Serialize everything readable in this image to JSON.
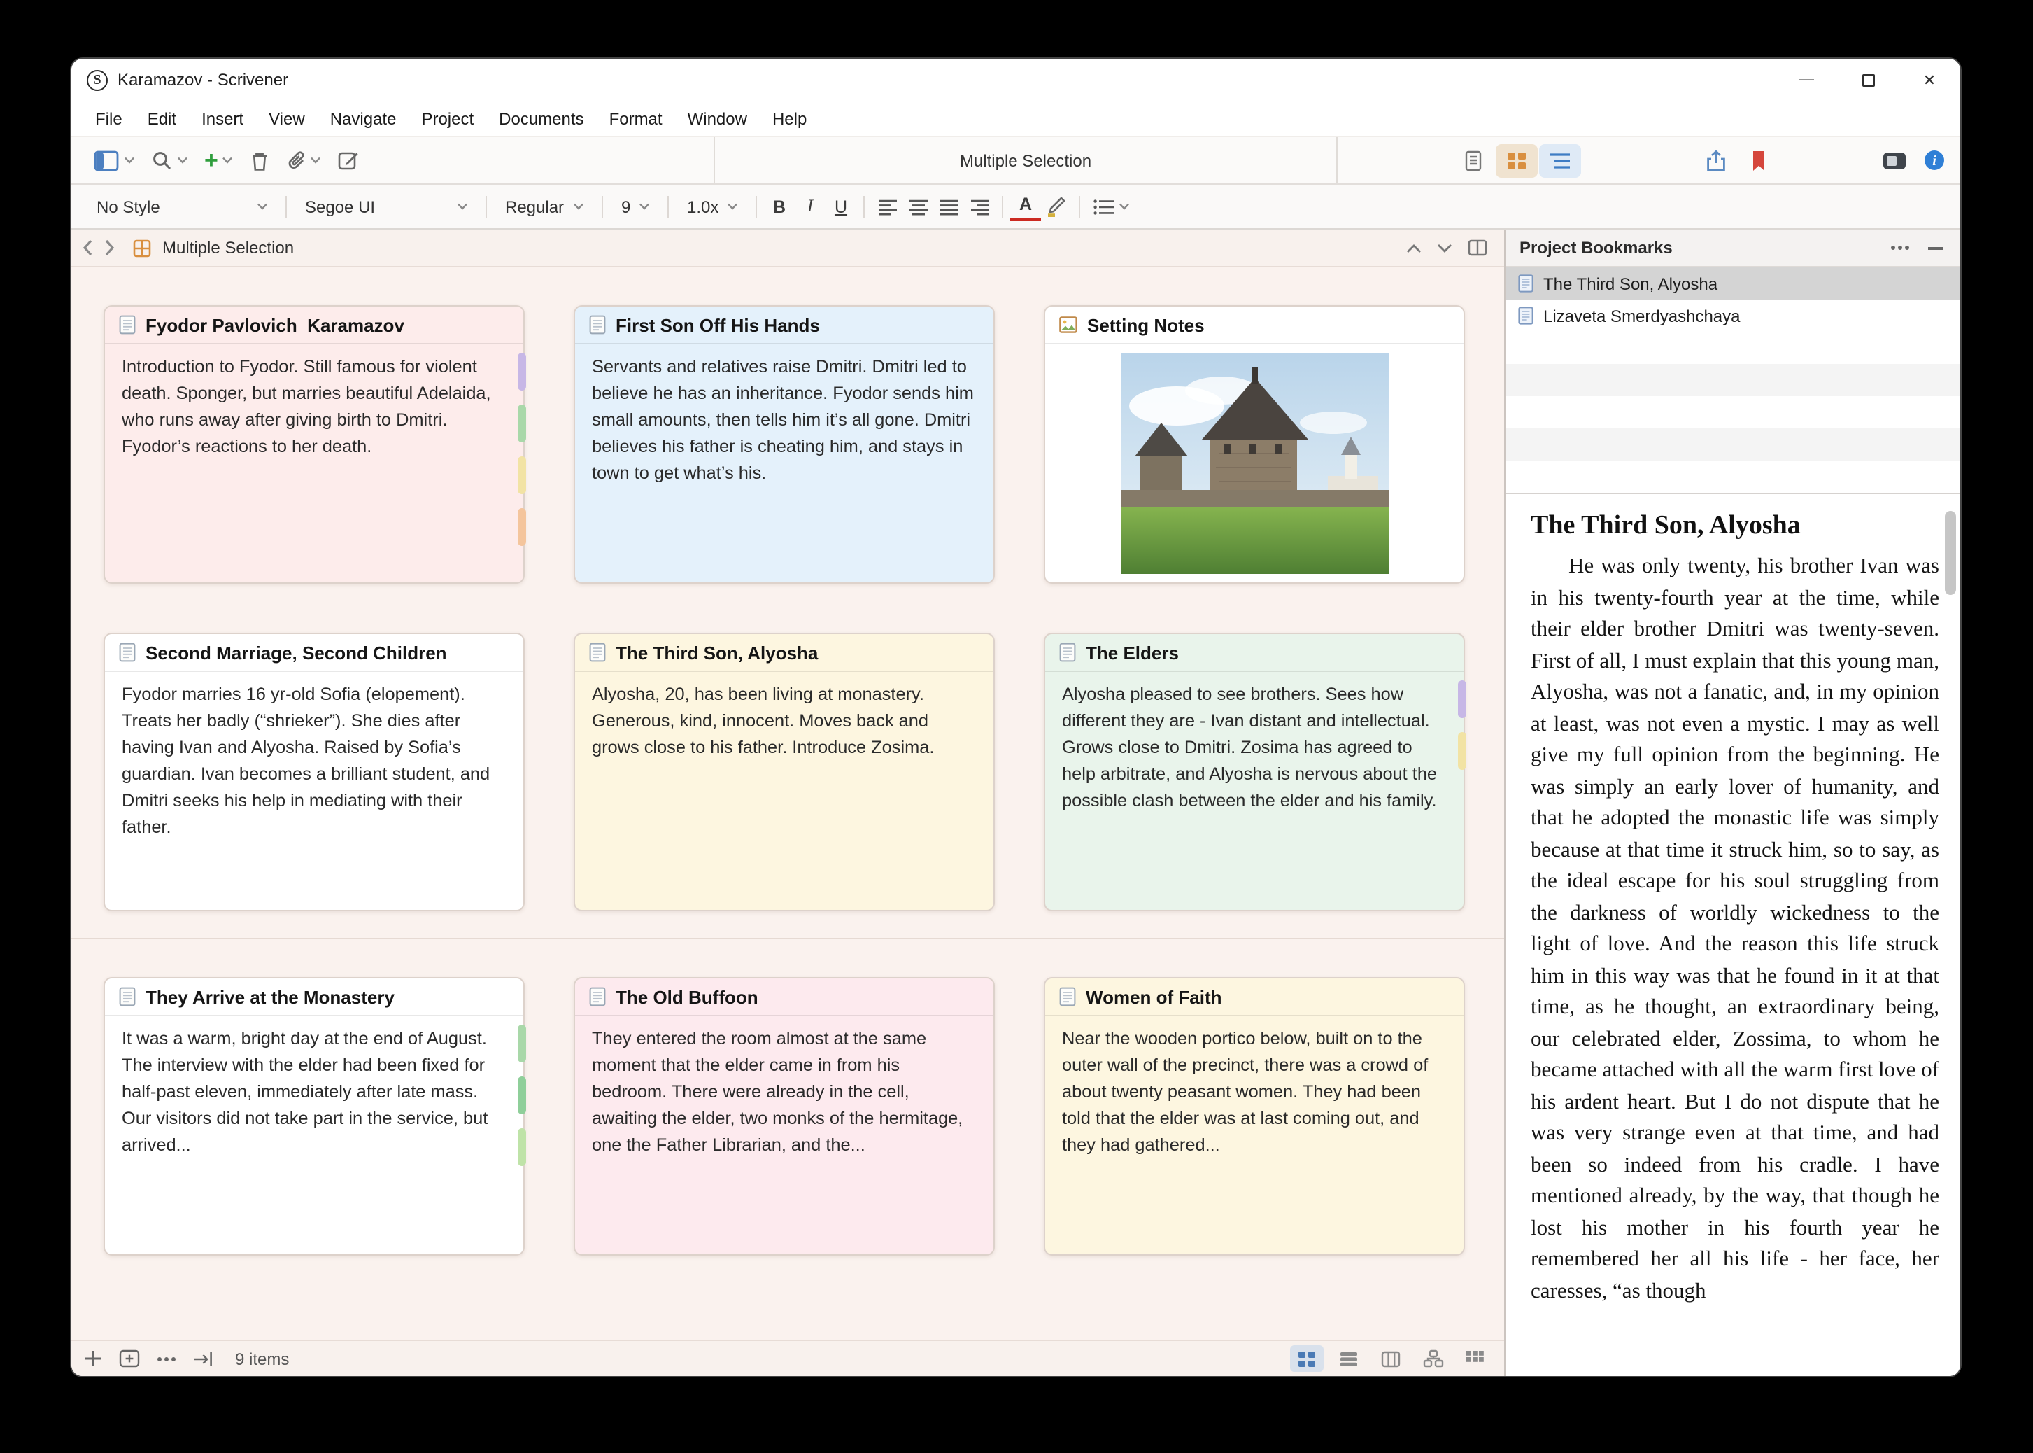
{
  "window": {
    "title": "Karamazov - Scrivener",
    "controls": {
      "minimize": "—",
      "maximize": "▢",
      "close": "✕"
    }
  },
  "menu": {
    "items": [
      "File",
      "Edit",
      "Insert",
      "View",
      "Navigate",
      "Project",
      "Documents",
      "Format",
      "Window",
      "Help"
    ]
  },
  "toolbar": {
    "document_title": "Multiple Selection"
  },
  "format_bar": {
    "style": "No Style",
    "font": "Segoe UI",
    "variant": "Regular",
    "size": "9",
    "line_spacing": "1.0x",
    "bold": "B",
    "italic": "I",
    "underline": "U",
    "color_letter": "A"
  },
  "editor_header": {
    "title": "Multiple Selection"
  },
  "icons": {
    "app-logo": "S-circle",
    "layout": "split-rectangle",
    "search": "magnifier",
    "add": "+",
    "trash": "trash-can",
    "attach": "paperclip",
    "compose": "square-pencil",
    "view-document": "page",
    "view-corkboard": "amber-grid",
    "view-outline": "blue-lines",
    "share": "arrow-up-box",
    "bookmark": "red-flag",
    "quick-reference": "dark-panel",
    "info": "blue-i",
    "back": "chevron-left",
    "forward": "chevron-right",
    "up": "chevron-up",
    "down": "chevron-down",
    "more": "three-dots",
    "collapse": "minus"
  },
  "corkboard": {
    "cards": [
      {
        "title": "Fyodor Pavlovich  Karamazov",
        "body": "Introduction to Fyodor. Still famous for violent death. Sponger, but marries beautiful Adelaida, who runs away after giving birth to Dmitri. Fyodor’s reactions to her death.",
        "color": "#fdeceb",
        "tabs": [
          "#c7b7e6",
          "#a9d8a9",
          "#f2e3a4",
          "#f4c59c"
        ]
      },
      {
        "title": "First Son Off His Hands",
        "body": "Servants and relatives raise Dmitri. Dmitri led to believe he has an inheritance. Fyodor sends him small amounts, then tells him it’s all gone. Dmitri believes his father is cheating him, and stays in town to get what’s his.",
        "color": "#e4f1fb",
        "tabs": []
      },
      {
        "title": "Setting Notes",
        "body": "",
        "color": "#ffffff",
        "tabs": [],
        "image": "monastery-tower-photo"
      },
      {
        "title": "Second Marriage, Second Children",
        "body": "Fyodor marries 16 yr-old Sofia (elopement). Treats her badly (“shrieker”). She dies after having Ivan and Alyosha. Raised by Sofia’s guardian. Ivan becomes a brilliant student, and Dmitri seeks his help in mediating with their father.",
        "color": "#ffffff",
        "tabs": []
      },
      {
        "title": "The Third Son, Alyosha",
        "body": "Alyosha, 20, has been living at monastery. Generous, kind, innocent. Moves back and grows close to his father. Introduce Zosima.",
        "color": "#fdf6e0",
        "tabs": []
      },
      {
        "title": "The Elders",
        "body": "Alyosha pleased to see brothers. Sees how different they are - Ivan distant and intellectual. Grows close to Dmitri. Zosima has agreed to help arbitrate, and Alyosha is nervous about the possible clash between the elder and his family.",
        "color": "#e9f4eb",
        "tabs": [
          "#c7b7e6",
          "#f2e3a4"
        ]
      },
      {
        "title": "They Arrive at the Monastery",
        "body": "It was a warm, bright day at the end of August. The interview with the elder had been fixed for half-past eleven, immediately after late mass. Our visitors did not take part in the service, but arrived...",
        "color": "#ffffff",
        "tabs": [
          "#a9d8a9",
          "#8fcf9a",
          "#bfe3a8"
        ]
      },
      {
        "title": "The Old Buffoon",
        "body": "They entered the room almost at the same moment that the elder came in from his bedroom. There were already in the cell, awaiting the elder, two monks of the hermitage, one the Father Librarian, and the...",
        "color": "#fdeaee",
        "tabs": []
      },
      {
        "title": "Women of Faith",
        "body": "Near the wooden portico below, built on to the outer wall of the precinct, there was a crowd of about twenty peasant women. They had been told that the elder was at last coming out, and they had gathered...",
        "color": "#fdf6e0",
        "tabs": []
      }
    ]
  },
  "status_bar": {
    "item_count": "9 items"
  },
  "inspector": {
    "title": "Project Bookmarks",
    "bookmarks": [
      {
        "label": "The Third Son, Alyosha",
        "selected": true
      },
      {
        "label": "Lizaveta Smerdyashchaya",
        "selected": false
      }
    ],
    "preview": {
      "title": "The Third Son, Alyosha",
      "body": "He was only twenty, his brother Ivan was in his twenty-fourth year at the time, while their elder brother Dmitri was twenty-seven. First of all, I must explain that this young man, Alyosha, was not a fanatic, and, in my opinion at least, was not even a mystic. I may as well give my full opinion from the beginning. He was simply an early lover of humanity, and that he adopted the monastic life was simply because at that time it struck him, so to say, as the ideal escape for his soul struggling from the darkness of worldly wickedness to the light of love. And the reason this life struck him in this way was that he found in it at that time, as he thought, an extraordinary being, our celebrated elder, Zossima, to whom he became attached with all the warm first love of his ardent heart. But I do not dispute that he was very strange even at that time, and had been so indeed from his cradle. I have mentioned already, by the way, that though he lost his mother in his fourth year he remembered her all his life - her face, her caresses, “as though"
    }
  }
}
